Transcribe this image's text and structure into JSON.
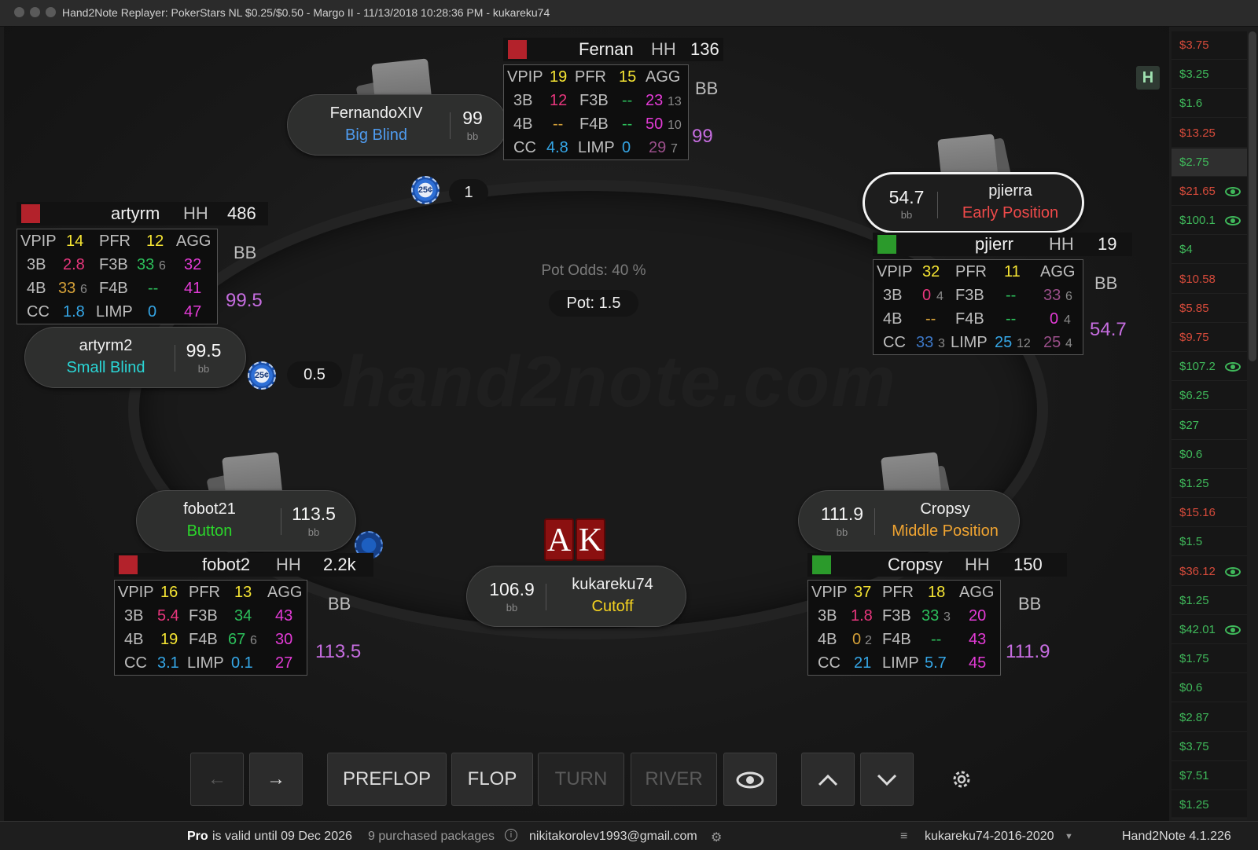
{
  "window": {
    "title": "Hand2Note Replayer: PokerStars NL $0.25/$0.50 - Margo II - 11/13/2018 10:28:36 PM - kukareku74"
  },
  "table": {
    "watermark": "hand2note.com",
    "pot_odds": "Pot Odds: 40 %",
    "pot": "Pot: 1.5",
    "logo": "H"
  },
  "seats": [
    {
      "name": "FernandoXIV",
      "position": "Big Blind",
      "stack": "99",
      "unit": "bb",
      "pos_color": "#4f9cf0"
    },
    {
      "name": "pjierra",
      "position": "Early Position",
      "stack": "54.7",
      "unit": "bb",
      "pos_color": "#ef4a4a"
    },
    {
      "name": "artyrm2",
      "position": "Small Blind",
      "stack": "99.5",
      "unit": "bb",
      "pos_color": "#2ad6d6"
    },
    {
      "name": "fobot21",
      "position": "Button",
      "stack": "113.5",
      "unit": "bb",
      "pos_color": "#2bd62b"
    },
    {
      "name": "Cropsy",
      "position": "Middle Position",
      "stack": "111.9",
      "unit": "bb",
      "pos_color": "#f0a431"
    },
    {
      "name": "kukareku74",
      "position": "Cutoff",
      "stack": "106.9",
      "unit": "bb",
      "pos_color": "#f5d320"
    }
  ],
  "bets": {
    "bb": "1",
    "sb": "0.5",
    "chip_label": "25¢"
  },
  "hero_cards": [
    "A",
    "K"
  ],
  "huds": {
    "fernan": {
      "name": "Fernan",
      "hh": "HH",
      "count": "136",
      "vpip": "19",
      "pfr": "15",
      "b3": "12",
      "f3b": "--",
      "b4": "--",
      "f4b": "--",
      "cc": "4.8",
      "limp": "0",
      "agg1": "23",
      "agg1s": "13",
      "agg2": "50",
      "agg2s": "10",
      "agg3": "29",
      "agg3s": "7",
      "bb": "BB",
      "bbval": "99"
    },
    "artyrm": {
      "name": "artyrm",
      "hh": "HH",
      "count": "486",
      "vpip": "14",
      "pfr": "12",
      "b3": "2.8",
      "f3b": "33",
      "f3bs": "6",
      "b4": "33",
      "b4s": "6",
      "f4b": "--",
      "cc": "1.8",
      "limp": "0",
      "agg1": "32",
      "agg2": "41",
      "agg3": "47",
      "bb": "BB",
      "bbval": "99.5"
    },
    "pjierr": {
      "name": "pjierr",
      "hh": "HH",
      "count": "19",
      "vpip": "32",
      "pfr": "11",
      "b3": "0",
      "b3s": "4",
      "f3b": "--",
      "b4": "--",
      "f4b": "--",
      "cc": "33",
      "ccs": "3",
      "limp": "25",
      "limps": "12",
      "agg1": "33",
      "agg1s": "6",
      "agg2": "0",
      "agg2s": "4",
      "agg3": "25",
      "agg3s": "4",
      "bb": "BB",
      "bbval": "54.7"
    },
    "fobot2": {
      "name": "fobot2",
      "hh": "HH",
      "count": "2.2k",
      "vpip": "16",
      "pfr": "13",
      "b3": "5.4",
      "f3b": "34",
      "b4": "19",
      "f4b": "67",
      "f4bs": "6",
      "cc": "3.1",
      "limp": "0.1",
      "agg1": "43",
      "agg2": "30",
      "agg3": "27",
      "bb": "BB",
      "bbval": "113.5"
    },
    "cropsy": {
      "name": "Cropsy",
      "hh": "HH",
      "count": "150",
      "vpip": "37",
      "pfr": "18",
      "b3": "1.8",
      "f3b": "33",
      "f3bs": "3",
      "b4": "0",
      "b4s": "2",
      "f4b": "--",
      "cc": "21",
      "limp": "5.7",
      "agg1": "20",
      "agg2": "43",
      "agg3": "45",
      "bb": "BB",
      "bbval": "111.9"
    }
  },
  "labels": {
    "vpip": "VPIP",
    "pfr": "PFR",
    "agg": "AGG",
    "b3": "3B",
    "f3b": "F3B",
    "b4": "4B",
    "f4b": "F4B",
    "cc": "CC",
    "limp": "LIMP"
  },
  "controls": {
    "back": "←",
    "forward": "→",
    "preflop": "PREFLOP",
    "flop": "FLOP",
    "turn": "TURN",
    "river": "RIVER",
    "eye": "eye-icon",
    "up": "up",
    "down": "down",
    "settings": "gear-icon"
  },
  "sidebar": [
    {
      "v": "$3.75",
      "t": "loss"
    },
    {
      "v": "$3.25",
      "t": "win"
    },
    {
      "v": "$1.6",
      "t": "win"
    },
    {
      "v": "$13.25",
      "t": "loss"
    },
    {
      "v": "$2.75",
      "t": "win",
      "sel": true
    },
    {
      "v": "$21.65",
      "t": "loss",
      "eye": true
    },
    {
      "v": "$100.1",
      "t": "win",
      "eye": true
    },
    {
      "v": "$4",
      "t": "win"
    },
    {
      "v": "$10.58",
      "t": "loss"
    },
    {
      "v": "$5.85",
      "t": "loss"
    },
    {
      "v": "$9.75",
      "t": "loss"
    },
    {
      "v": "$107.2",
      "t": "win",
      "eye": true
    },
    {
      "v": "$6.25",
      "t": "win"
    },
    {
      "v": "$27",
      "t": "win"
    },
    {
      "v": "$0.6",
      "t": "win"
    },
    {
      "v": "$1.25",
      "t": "win"
    },
    {
      "v": "$15.16",
      "t": "loss"
    },
    {
      "v": "$1.5",
      "t": "win"
    },
    {
      "v": "$36.12",
      "t": "loss",
      "eye": true
    },
    {
      "v": "$1.25",
      "t": "win"
    },
    {
      "v": "$42.01",
      "t": "win",
      "eye": true
    },
    {
      "v": "$1.75",
      "t": "win"
    },
    {
      "v": "$0.6",
      "t": "win"
    },
    {
      "v": "$2.87",
      "t": "win"
    },
    {
      "v": "$3.75",
      "t": "win"
    },
    {
      "v": "$7.51",
      "t": "win"
    },
    {
      "v": "$1.25",
      "t": "win"
    }
  ],
  "status": {
    "pro": "Pro",
    "valid": "is valid until 09 Dec 2026",
    "packages": "9 purchased packages",
    "email": "nikitakorolev1993@gmail.com",
    "db": "kukareku74-2016-2020",
    "version": "Hand2Note 4.1.226"
  }
}
